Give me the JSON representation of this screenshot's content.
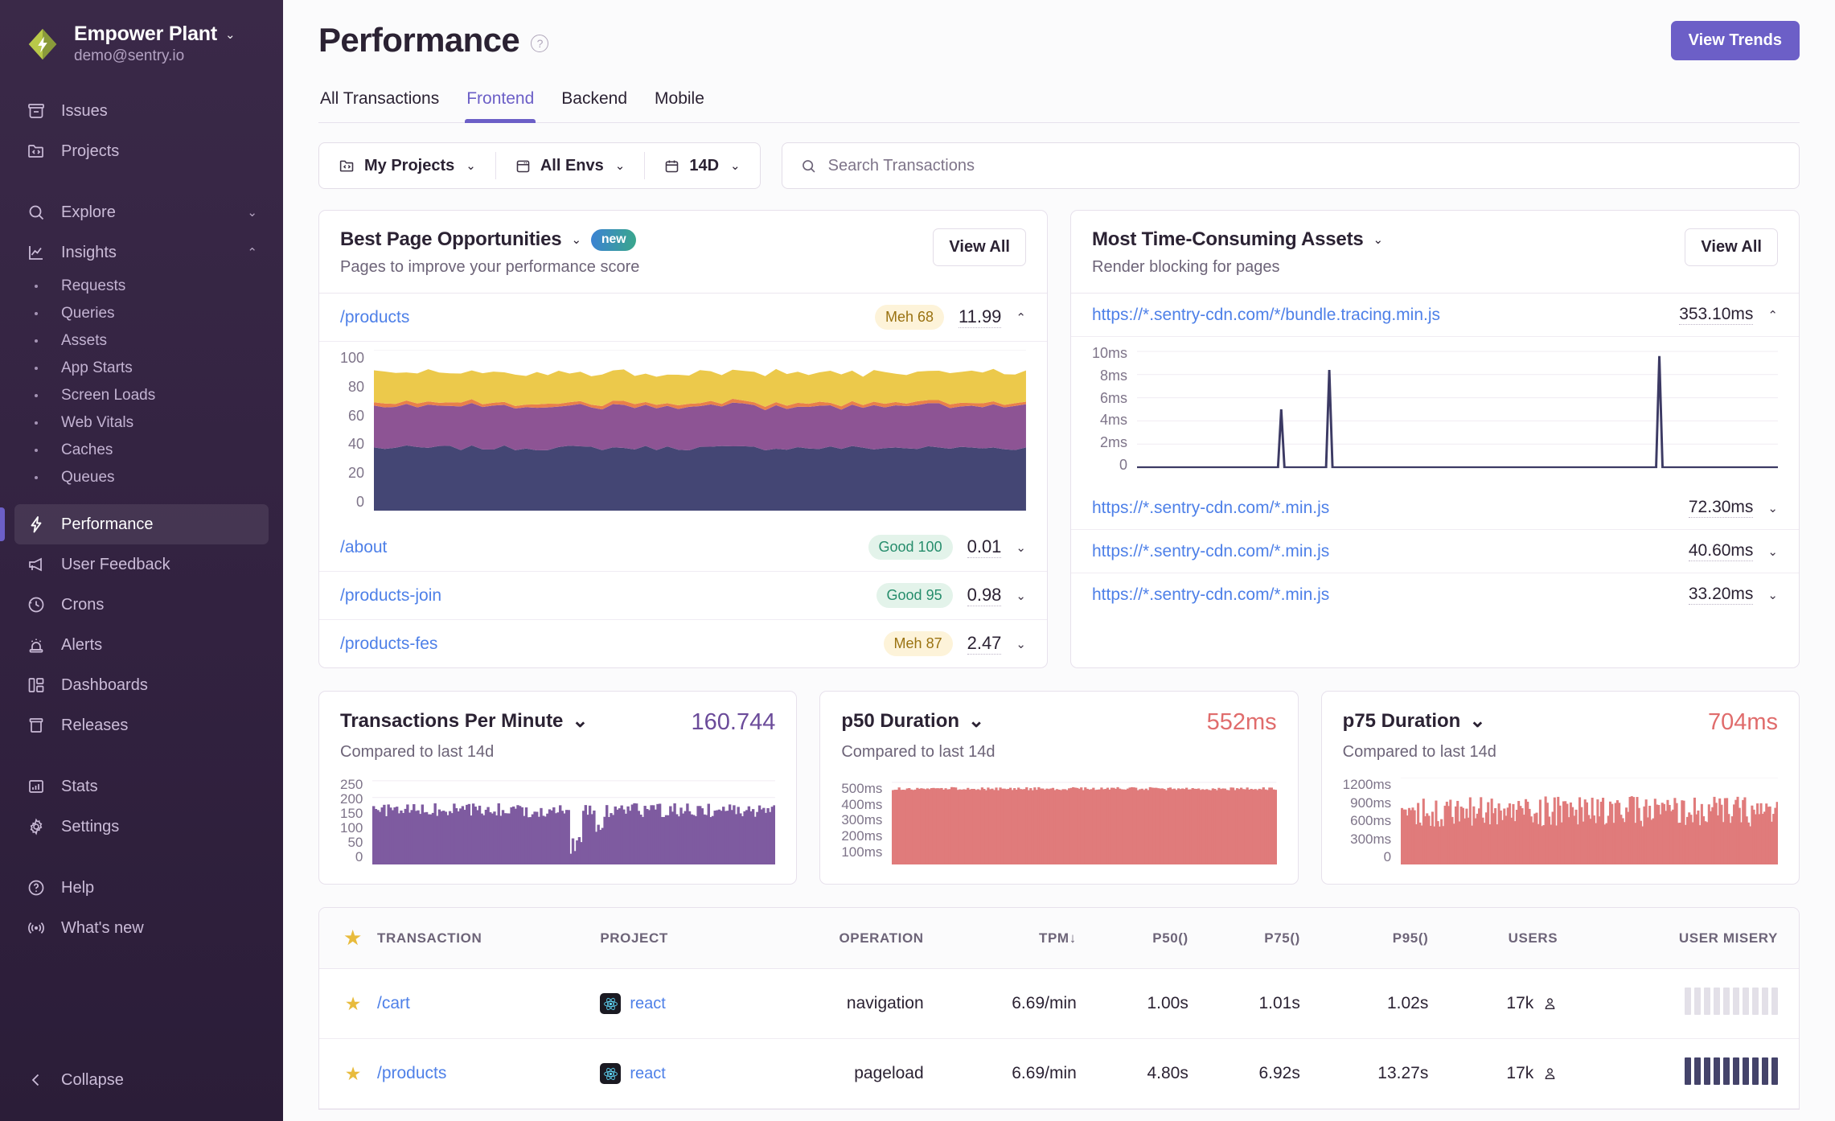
{
  "sidebar": {
    "org": {
      "name": "Empower Plant",
      "email": "demo@sentry.io",
      "chevron": "⌄"
    },
    "primary": [
      {
        "label": "Issues",
        "icon": "issues-icon"
      },
      {
        "label": "Projects",
        "icon": "projects-icon"
      }
    ],
    "sections": [
      {
        "label": "Explore",
        "icon": "search-icon",
        "tail": "⌄"
      },
      {
        "label": "Insights",
        "icon": "insights-icon",
        "tail": "⌃"
      }
    ],
    "insights_children": [
      {
        "label": "Requests"
      },
      {
        "label": "Queries"
      },
      {
        "label": "Assets"
      },
      {
        "label": "App Starts"
      },
      {
        "label": "Screen Loads"
      },
      {
        "label": "Web Vitals"
      },
      {
        "label": "Caches"
      },
      {
        "label": "Queues"
      }
    ],
    "monitors": [
      {
        "label": "Performance",
        "icon": "lightning-icon",
        "active": true
      },
      {
        "label": "User Feedback",
        "icon": "megaphone-icon",
        "active": false
      },
      {
        "label": "Crons",
        "icon": "clock-icon",
        "active": false
      },
      {
        "label": "Alerts",
        "icon": "siren-icon",
        "active": false
      },
      {
        "label": "Dashboards",
        "icon": "dashboard-icon",
        "active": false
      },
      {
        "label": "Releases",
        "icon": "releases-icon",
        "active": false
      }
    ],
    "admin": [
      {
        "label": "Stats",
        "icon": "stats-icon"
      },
      {
        "label": "Settings",
        "icon": "gear-icon"
      }
    ],
    "support": [
      {
        "label": "Help",
        "icon": "question-circle-icon"
      },
      {
        "label": "What's new",
        "icon": "broadcast-icon"
      }
    ],
    "collapse": {
      "label": "Collapse",
      "icon": "chevron-left-icon"
    }
  },
  "header": {
    "title": "Performance",
    "help_icon": "question-circle-icon",
    "view_trends_label": "View Trends",
    "tabs": [
      {
        "label": "All Transactions",
        "active": false
      },
      {
        "label": "Frontend",
        "active": true
      },
      {
        "label": "Backend",
        "active": false
      },
      {
        "label": "Mobile",
        "active": false
      }
    ]
  },
  "filters": {
    "projects": {
      "label": "My Projects",
      "icon": "projects-icon",
      "chevron": "⌄"
    },
    "envs": {
      "label": "All Envs",
      "icon": "window-icon",
      "chevron": "⌄"
    },
    "date": {
      "label": "14D",
      "icon": "calendar-icon",
      "chevron": "⌄"
    },
    "search": {
      "placeholder": "Search Transactions",
      "value": "",
      "icon": "search-icon"
    }
  },
  "best_page_opportunities": {
    "title": "Best Page Opportunities",
    "title_chevron": "⌄",
    "badge": "new",
    "subtitle": "Pages to improve your performance score",
    "view_all_label": "View All",
    "rows": [
      {
        "path": "/products",
        "pill": "Meh 68",
        "pill_type": "meh",
        "value": "11.99",
        "expanded": true,
        "caret": "⌃"
      },
      {
        "path": "/about",
        "pill": "Good 100",
        "pill_type": "good",
        "value": "0.01",
        "expanded": false,
        "caret": "⌄"
      },
      {
        "path": "/products-join",
        "pill": "Good 95",
        "pill_type": "good",
        "value": "0.98",
        "expanded": false,
        "caret": "⌄"
      },
      {
        "path": "/products-fes",
        "pill": "Meh 87",
        "pill_type": "meh",
        "value": "2.47",
        "expanded": false,
        "caret": "⌄"
      }
    ]
  },
  "most_time_consuming_assets": {
    "title": "Most Time-Consuming Assets",
    "title_chevron": "⌄",
    "subtitle": "Render blocking for pages",
    "view_all_label": "View All",
    "rows": [
      {
        "url": "https://*.sentry-cdn.com/*/bundle.tracing.min.js",
        "value": "353.10ms",
        "expanded": true,
        "caret": "⌃"
      },
      {
        "url": "https://*.sentry-cdn.com/*.min.js",
        "value": "72.30ms",
        "expanded": false,
        "caret": "⌄"
      },
      {
        "url": "https://*.sentry-cdn.com/*.min.js",
        "value": "40.60ms",
        "expanded": false,
        "caret": "⌄"
      },
      {
        "url": "https://*.sentry-cdn.com/*.min.js",
        "value": "33.20ms",
        "expanded": false,
        "caret": "⌄"
      }
    ]
  },
  "widgets": [
    {
      "title": "Transactions Per Minute",
      "chevron": "⌄",
      "value": "160.744",
      "value_color": "#6b4b9a",
      "subtitle": "Compared to last 14d",
      "ticks": [
        "250",
        "200",
        "150",
        "100",
        "50",
        "0"
      ]
    },
    {
      "title": "p50 Duration",
      "chevron": "⌄",
      "value": "552ms",
      "value_color": "#e06c6c",
      "subtitle": "Compared to last 14d",
      "ticks": [
        "500ms",
        "400ms",
        "300ms",
        "200ms",
        "100ms"
      ]
    },
    {
      "title": "p75 Duration",
      "chevron": "⌄",
      "value": "704ms",
      "value_color": "#e06c6c",
      "subtitle": "Compared to last 14d",
      "ticks": [
        "1200ms",
        "900ms",
        "600ms",
        "300ms",
        "0"
      ]
    }
  ],
  "table": {
    "columns": [
      "TRANSACTION",
      "PROJECT",
      "OPERATION",
      "TPM",
      "P50()",
      "P75()",
      "P95()",
      "USERS",
      "USER MISERY"
    ],
    "sort_column": "TPM",
    "sort_arrow": "↓",
    "star_icon": "star-icon",
    "rows": [
      {
        "starred": true,
        "transaction": "/cart",
        "project": "react",
        "project_icon": "react-icon",
        "operation": "navigation",
        "tpm": "6.69/min",
        "p50": "1.00s",
        "p75": "1.01s",
        "p95": "1.02s",
        "users": "17k",
        "misery_filled": 0,
        "misery_total": 10
      },
      {
        "starred": true,
        "transaction": "/products",
        "project": "react",
        "project_icon": "react-icon",
        "operation": "pageload",
        "tpm": "6.69/min",
        "p50": "4.80s",
        "p75": "6.92s",
        "p95": "13.27s",
        "users": "17k",
        "misery_filled": 10,
        "misery_total": 10
      }
    ]
  },
  "chart_data": [
    {
      "type": "area",
      "title": "/products performance score breakdown",
      "stacked": true,
      "ylim": [
        0,
        100
      ],
      "yticks": [
        0,
        20,
        40,
        60,
        80,
        100
      ],
      "series": [
        {
          "name": "series-1",
          "color": "#444674",
          "mean": 39
        },
        {
          "name": "series-2",
          "color": "#8d5494",
          "mean": 26
        },
        {
          "name": "series-3",
          "color": "#e9804a",
          "mean": 2
        },
        {
          "name": "series-4",
          "color": "#ecc94b",
          "mean": 19
        }
      ]
    },
    {
      "type": "line",
      "title": "https://*.sentry-cdn.com/*/bundle.tracing.min.js duration",
      "ylim": [
        0,
        10
      ],
      "yticks": [
        "0",
        "2ms",
        "4ms",
        "6ms",
        "8ms",
        "10ms"
      ],
      "color": "#3c3a64",
      "spikes": [
        {
          "x": 0.225,
          "y": 5.0
        },
        {
          "x": 0.3,
          "y": 8.4
        },
        {
          "x": 0.815,
          "y": 9.6
        }
      ],
      "baseline": 0
    },
    {
      "type": "area",
      "title": "Transactions Per Minute",
      "ylim": [
        0,
        250
      ],
      "yticks": [
        250,
        200,
        150,
        100,
        50,
        0
      ],
      "color": "#7e5ba0",
      "mean": 160
    },
    {
      "type": "area",
      "title": "p50 Duration",
      "ylim": [
        0,
        600
      ],
      "yticks": [
        500,
        400,
        300,
        200,
        100
      ],
      "color": "#e07b7b",
      "mean": 552
    },
    {
      "type": "area",
      "title": "p75 Duration",
      "ylim": [
        0,
        1200
      ],
      "yticks": [
        1200,
        900,
        600,
        300,
        0
      ],
      "color": "#e07b7b",
      "mean": 704
    }
  ]
}
